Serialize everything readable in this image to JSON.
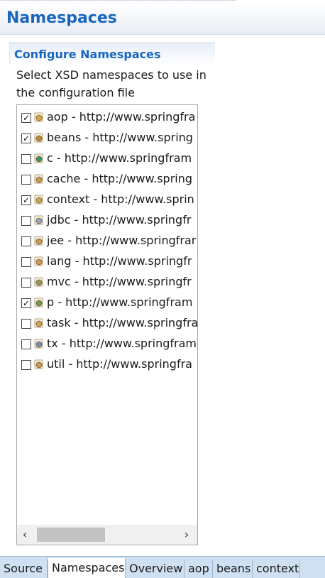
{
  "header": {
    "title": "Namespaces"
  },
  "section": {
    "title": "Configure Namespaces",
    "description": "Select XSD namespaces to use in the configuration file"
  },
  "namespaces": [
    {
      "label": "aop - http://www.springfra",
      "checked": true,
      "icon": "aop-icon"
    },
    {
      "label": "beans - http://www.spring",
      "checked": true,
      "icon": "beans-icon"
    },
    {
      "label": "c - http://www.springfram",
      "checked": false,
      "icon": "c-icon"
    },
    {
      "label": "cache - http://www.spring",
      "checked": false,
      "icon": "cache-icon"
    },
    {
      "label": "context - http://www.sprin",
      "checked": true,
      "icon": "context-icon"
    },
    {
      "label": "jdbc - http://www.springfr",
      "checked": false,
      "icon": "jdbc-icon"
    },
    {
      "label": "jee - http://www.springfrar",
      "checked": false,
      "icon": "jee-icon"
    },
    {
      "label": "lang - http://www.springfr",
      "checked": false,
      "icon": "lang-icon"
    },
    {
      "label": "mvc - http://www.springfr",
      "checked": false,
      "icon": "mvc-icon"
    },
    {
      "label": "p - http://www.springfram",
      "checked": true,
      "icon": "p-icon"
    },
    {
      "label": "task - http://www.springfra",
      "checked": false,
      "icon": "task-icon"
    },
    {
      "label": "tx - http://www.springfram",
      "checked": false,
      "icon": "tx-icon"
    },
    {
      "label": "util - http://www.springfra",
      "checked": false,
      "icon": "util-icon"
    }
  ],
  "scroll": {
    "left": "‹",
    "right": "›"
  },
  "tabs": [
    {
      "label": "Source",
      "active": false
    },
    {
      "label": "Namespaces",
      "active": true
    },
    {
      "label": "Overview",
      "active": false
    },
    {
      "label": "aop",
      "active": false
    },
    {
      "label": "beans",
      "active": false
    },
    {
      "label": "context",
      "active": false
    }
  ]
}
